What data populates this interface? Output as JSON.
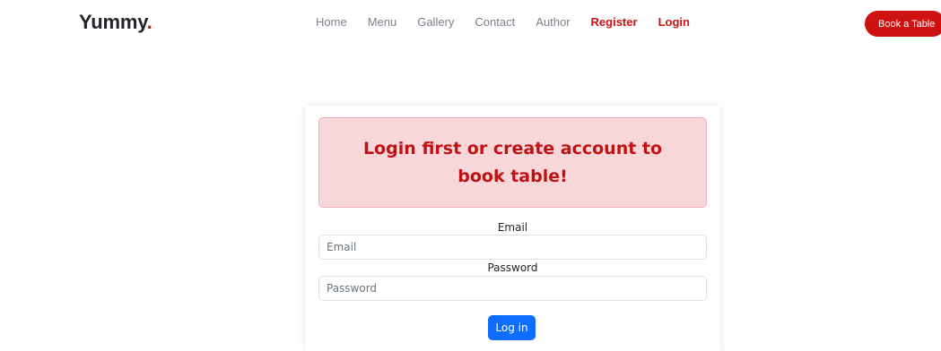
{
  "brand": {
    "name": "Yummy",
    "dot": "."
  },
  "nav": {
    "items": [
      {
        "label": "Home"
      },
      {
        "label": "Menu"
      },
      {
        "label": "Gallery"
      },
      {
        "label": "Contact"
      },
      {
        "label": "Author"
      },
      {
        "label": "Register"
      },
      {
        "label": "Login"
      }
    ]
  },
  "header": {
    "cta_label": "Book a Table"
  },
  "alert": {
    "message": "Login first or create account to book table!"
  },
  "form": {
    "email_label": "Email",
    "email_placeholder": "Email",
    "email_value": "",
    "password_label": "Password",
    "password_placeholder": "Password",
    "password_value": "",
    "submit_label": "Log in"
  },
  "colors": {
    "accent": "#ce1212",
    "alert_bg": "#f8d7da",
    "button_primary": "#0d6efd"
  }
}
